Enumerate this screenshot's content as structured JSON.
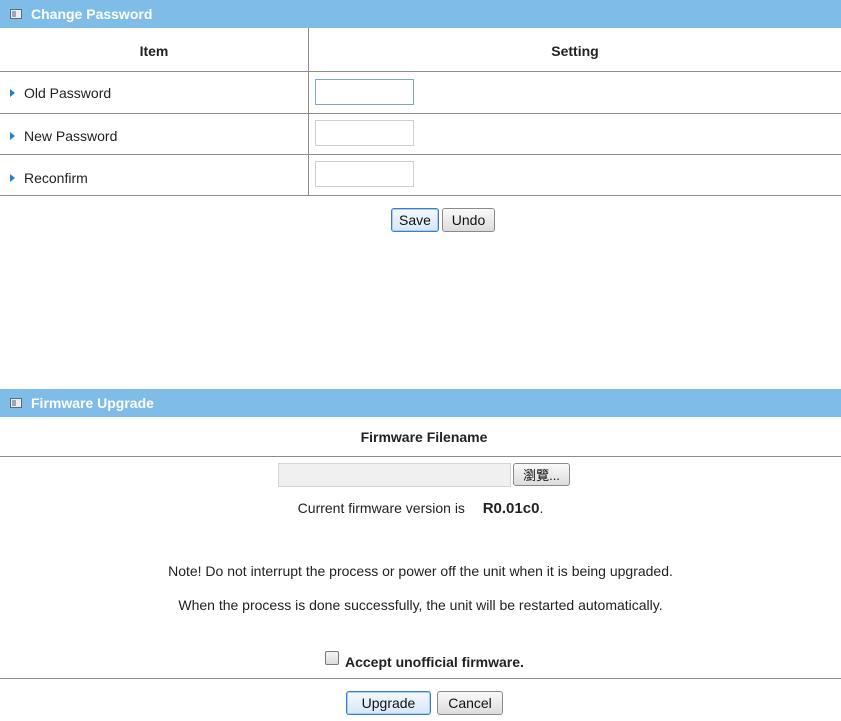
{
  "change_password": {
    "title": "Change Password",
    "col_item": "Item",
    "col_setting": "Setting",
    "rows": [
      {
        "label": "Old Password",
        "value": ""
      },
      {
        "label": "New Password",
        "value": ""
      },
      {
        "label": "Reconfirm",
        "value": ""
      }
    ],
    "save_label": "Save",
    "undo_label": "Undo"
  },
  "firmware": {
    "title": "Firmware Upgrade",
    "filename_header": "Firmware Filename",
    "browse_label": "瀏覽...",
    "version_prefix": "Current firmware version is",
    "version": "R0.01c0",
    "version_suffix": ".",
    "note1": "Note! Do not interrupt the process or power off the unit when it is being upgraded.",
    "note2": "When the process is done successfully, the unit will be restarted automatically.",
    "accept_label": "Accept unofficial firmware.",
    "accept_checked": false,
    "upgrade_label": "Upgrade",
    "cancel_label": "Cancel"
  },
  "colors": {
    "header_bg": "#7fbde8",
    "arrow": "#2c7fc0"
  }
}
